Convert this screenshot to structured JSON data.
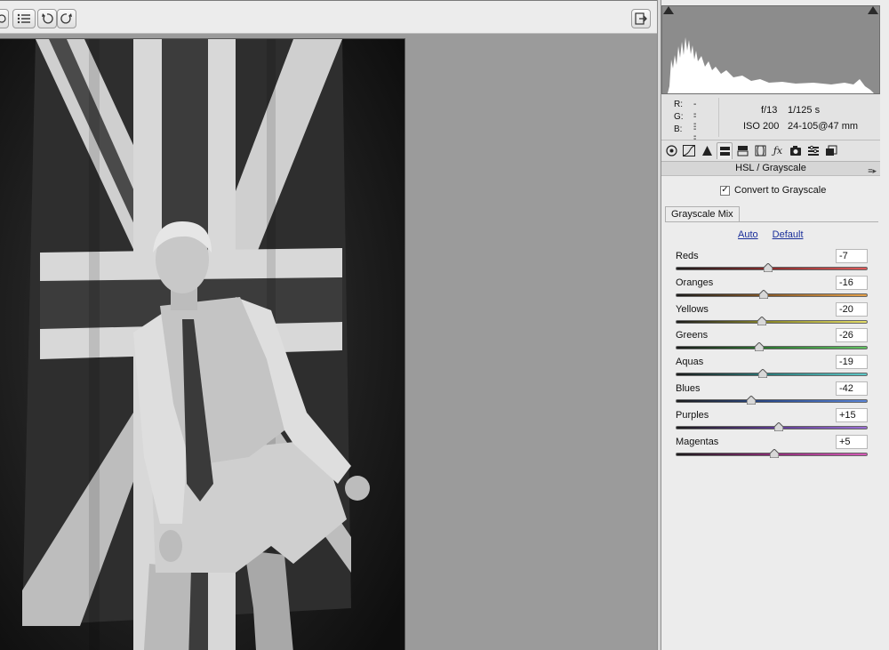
{
  "toolbar": {
    "buttons": [
      "preview-toggle",
      "list",
      "rotate-left",
      "rotate-right",
      "export"
    ]
  },
  "info": {
    "r_label": "R:",
    "r_value": "---",
    "g_label": "G:",
    "g_value": "---",
    "b_label": "B:",
    "b_value": "---",
    "aperture": "f/13",
    "shutter": "1/125 s",
    "iso": "ISO 200",
    "lens": "24-105@47 mm"
  },
  "panel": {
    "title": "HSL / Grayscale",
    "convert_label": "Convert to Grayscale",
    "convert_checked": "✓",
    "subtab": "Grayscale Mix",
    "auto_link": "Auto",
    "default_link": "Default",
    "sliders": [
      {
        "label": "Reds",
        "value": "-7",
        "num": -7,
        "grad": "linear-gradient(90deg,#1a1a1a,#8a2c2c 50%,#e15a5a)"
      },
      {
        "label": "Oranges",
        "value": "-16",
        "num": -16,
        "grad": "linear-gradient(90deg,#1a1a1a,#8a5a26 50%,#e7a24a)"
      },
      {
        "label": "Yellows",
        "value": "-20",
        "num": -20,
        "grad": "linear-gradient(90deg,#1a1a1a,#8d8a2a 50%,#e7e06a)"
      },
      {
        "label": "Greens",
        "value": "-26",
        "num": -26,
        "grad": "linear-gradient(90deg,#1a1a1a,#2f7a33 50%,#62c462)"
      },
      {
        "label": "Aquas",
        "value": "-19",
        "num": -19,
        "grad": "linear-gradient(90deg,#1a1a1a,#2b7b7b 50%,#5ec9c9)"
      },
      {
        "label": "Blues",
        "value": "-42",
        "num": -42,
        "grad": "linear-gradient(90deg,#1a1a1a,#2a4b8e 50%,#5b86d9)"
      },
      {
        "label": "Purples",
        "value": "+15",
        "num": 15,
        "grad": "linear-gradient(90deg,#1a1a1a,#5b3a8e 50%,#9a6ed6)"
      },
      {
        "label": "Magentas",
        "value": "+5",
        "num": 5,
        "grad": "linear-gradient(90deg,#1a1a1a,#8a2a74 50%,#d75ab8)"
      }
    ]
  },
  "panel_tabs": [
    "basic-icon",
    "tone-curve-icon",
    "detail-icon",
    "hsl-grayscale-icon",
    "split-toning-icon",
    "lens-corrections-icon",
    "effects-icon",
    "camera-calibration-icon",
    "presets-icon",
    "snapshots-icon"
  ]
}
